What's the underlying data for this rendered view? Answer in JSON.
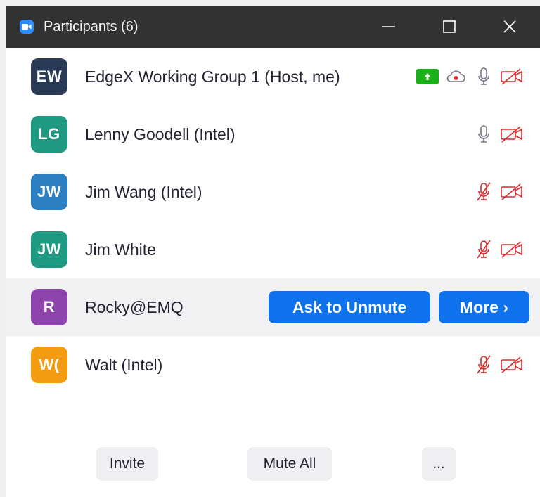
{
  "window": {
    "title": "Participants (6)"
  },
  "participants": [
    {
      "initials": "EW",
      "name": "EdgeX Working Group 1 (Host, me)",
      "avatar_color": "#2a3a55",
      "mic": "on",
      "video": "off",
      "sharing": true,
      "recording": true
    },
    {
      "initials": "LG",
      "name": "Lenny Goodell (Intel)",
      "avatar_color": "#1f9a82",
      "mic": "on",
      "video": "off"
    },
    {
      "initials": "JW",
      "name": "Jim Wang (Intel)",
      "avatar_color": "#2c7fc1",
      "mic": "muted",
      "video": "off"
    },
    {
      "initials": "JW",
      "name": "Jim White",
      "avatar_color": "#1f9a82",
      "mic": "muted",
      "video": "off"
    },
    {
      "initials": "R",
      "name": "Rocky@EMQ",
      "avatar_color": "#8e44ad",
      "hovered": true,
      "ask_to_unmute_label": "Ask to Unmute",
      "more_label": "More ›"
    },
    {
      "initials": "W(",
      "name": "Walt (Intel)",
      "avatar_color": "#f39c12",
      "mic": "muted",
      "video": "off"
    }
  ],
  "footer": {
    "invite_label": "Invite",
    "mute_all_label": "Mute All",
    "more_label": "..."
  },
  "colors": {
    "accent": "#0e72ed",
    "muted_red": "#e02828",
    "share_green": "#1ab01a"
  }
}
